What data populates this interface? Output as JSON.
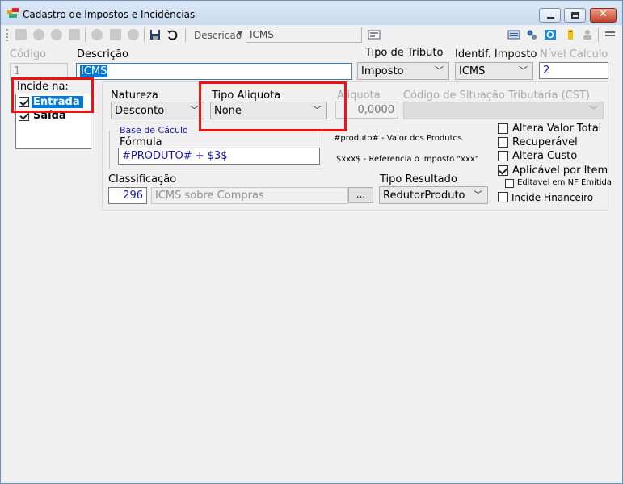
{
  "window": {
    "title": "Cadastro de Impostos e Incidências",
    "close_glyph": "✕"
  },
  "toolbar": {
    "search_label": "Descricao",
    "search_value": "ICMS",
    "icons": [
      "first-icon",
      "prev-icon",
      "next-icon",
      "last-icon",
      "add-icon",
      "edit-icon",
      "delete-icon",
      "save-icon",
      "undo-icon",
      "search-icon",
      "layout-icon",
      "settings-icon",
      "refresh-icon",
      "report-icon",
      "user-icon",
      "exit-icon"
    ]
  },
  "form": {
    "codigo": {
      "label": "Código",
      "value": "1"
    },
    "descricao": {
      "label": "Descrição",
      "value": "ICMS"
    },
    "tipo_tributo": {
      "label": "Tipo de Tributo",
      "value": "Imposto"
    },
    "identif_imposto": {
      "label": "Identif. Imposto",
      "value": "ICMS"
    },
    "nivel_calculo": {
      "label": "Nível Calculo",
      "value": "2"
    },
    "incide": {
      "label": "Incide na:",
      "entrada": "Entrada",
      "saida": "Saída"
    },
    "natureza": {
      "label": "Natureza",
      "value": "Desconto"
    },
    "tipo_aliquota": {
      "label": "Tipo Aliquota",
      "value": "None"
    },
    "aliquota": {
      "label": "Aliquota",
      "value": "0,0000"
    },
    "cst": {
      "label": "Código de Situação Tributária (CST)",
      "value": ""
    },
    "base_calculo": {
      "label": "Base de Cáculo",
      "formula_label": "Fórmula",
      "formula_value": "#PRODUTO# + $3$"
    },
    "hints": {
      "produto": "#produto# - Valor dos Produtos",
      "xxx": "$xxx$ - Referencia o imposto \"xxx\""
    },
    "classificacao": {
      "label": "Classificação",
      "code": "296",
      "description": "ICMS sobre Compras",
      "button": "..."
    },
    "tipo_resultado": {
      "label": "Tipo Resultado",
      "value": "RedutorProduto"
    },
    "options": [
      {
        "label": "Altera Valor Total",
        "checked": false
      },
      {
        "label": "Recuperável",
        "checked": false
      },
      {
        "label": "Altera Custo",
        "checked": false
      },
      {
        "label": "Aplicável por Item",
        "checked": true
      },
      {
        "label": "Editavel em NF Emitida",
        "checked": false
      },
      {
        "label": "Incide Financeiro",
        "checked": false
      }
    ]
  },
  "colors": {
    "highlight": "#e11111",
    "selection": "#0078d7",
    "link_blue": "#1515b0"
  }
}
